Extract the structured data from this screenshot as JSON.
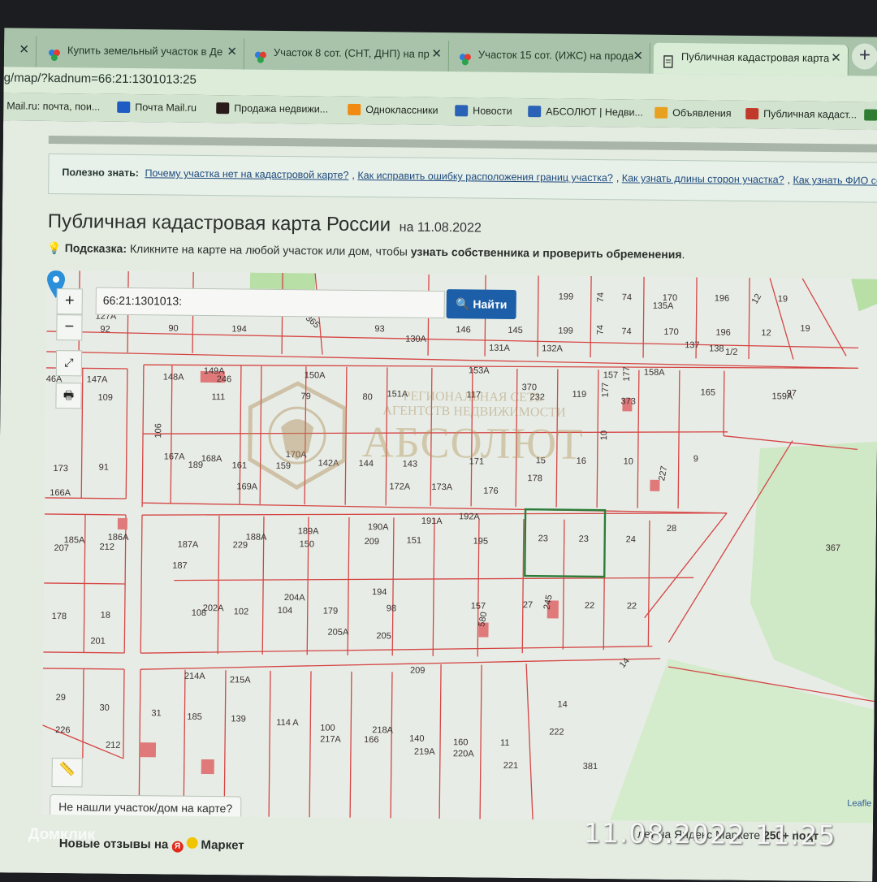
{
  "tabs": [
    {
      "label": "Купить земельный участок в Де",
      "active": false
    },
    {
      "label": "Участок 8 сот. (СНТ, ДНП) на пр",
      "active": false
    },
    {
      "label": "Участок 15 сот. (ИЖС) на прода",
      "active": false
    },
    {
      "label": "Публичная кадастровая карта -",
      "active": true
    }
  ],
  "address": "g/map/?kadnum=66:21:1301013:25",
  "bookmarks": [
    {
      "label": "Mail.ru: почта, пои...",
      "icon": "mailru-icon"
    },
    {
      "label": "Почта Mail.ru",
      "icon": "mail-icon"
    },
    {
      "label": "Продажа недвижи...",
      "icon": "site-icon"
    },
    {
      "label": "Одноклассники",
      "icon": "ok-icon"
    },
    {
      "label": "Новости",
      "icon": "vk-icon"
    },
    {
      "label": "АБСОЛЮТ | Недви...",
      "icon": "vk-icon"
    },
    {
      "label": "Объявления",
      "icon": "house-icon"
    },
    {
      "label": "Публичная кадаст...",
      "icon": "map-icon"
    }
  ],
  "info": {
    "title": "Полезно знать:",
    "links": [
      "Почему участка нет на кадастровой карте?",
      "Как исправить ошибку расположения границ участка?",
      "Как узнать длины сторон участка?",
      "Как узнать ФИО собс"
    ]
  },
  "heading": {
    "title": "Публичная кадастровая карта России",
    "date": "на 11.08.2022"
  },
  "hint": {
    "label": "Подсказка:",
    "text": "Кликните на карте на любой участок или дом, чтобы",
    "bold": "узнать собственника и проверить обременения",
    "end": "."
  },
  "map": {
    "search_value": "66:21:1301013:",
    "find_button": "Найти",
    "zoom_in": "+",
    "zoom_out": "−",
    "watermark_line1": "РЕГИОНАЛЬНАЯ СЕТЬ",
    "watermark_line2": "АГЕНТСТВ НЕДВИЖИМОСТИ",
    "watermark_brand": "АБСОЛЮТ",
    "not_found": "Не нашли участок/дом на карте?",
    "attribution": "Leafle",
    "parcel_labels": [
      "127A",
      "92",
      "90",
      "194",
      "365",
      "93",
      "130A",
      "146",
      "145",
      "199",
      "199",
      "74",
      "74",
      "74",
      "74",
      "170",
      "170",
      "135A",
      "196",
      "196",
      "12",
      "12",
      "19",
      "19",
      "131A",
      "132A",
      "137",
      "138",
      "1/2",
      "46A",
      "147A",
      "109",
      "148A",
      "149A",
      "246",
      "111",
      "150A",
      "79",
      "80",
      "151A",
      "153A",
      "117",
      "370",
      "232",
      "119",
      "157",
      "177",
      "177",
      "373",
      "158A",
      "165",
      "159A",
      "97",
      "106",
      "167A",
      "168A",
      "189",
      "161",
      "159",
      "170A",
      "142A",
      "144",
      "143",
      "171",
      "15",
      "16",
      "178",
      "10",
      "10",
      "9",
      "227",
      "173",
      "91",
      "166A",
      "169A",
      "172A",
      "173A",
      "176",
      "185A",
      "186A",
      "207",
      "212",
      "187A",
      "188A",
      "229",
      "189A",
      "150",
      "190A",
      "209",
      "191A",
      "151",
      "192A",
      "195",
      "23",
      "23",
      "24",
      "28",
      "367",
      "187",
      "204A",
      "194",
      "98",
      "157",
      "580",
      "27",
      "245",
      "22",
      "22",
      "108",
      "202A",
      "102",
      "104",
      "179",
      "178",
      "18",
      "201",
      "205A",
      "205",
      "209",
      "214A",
      "215A",
      "14",
      "29",
      "30",
      "31",
      "185",
      "139",
      "114 A",
      "100",
      "217A",
      "218A",
      "166",
      "140",
      "219A",
      "160",
      "220A",
      "11",
      "221",
      "14",
      "222",
      "381",
      "226",
      "212"
    ]
  },
  "footer": {
    "reviews_prefix": "Новые отзывы на",
    "reviews_brand": "Маркет",
    "right_text": "лет на Яндекс Маркете",
    "right_count": "250+ подт"
  },
  "overlay": {
    "timestamp": "11.08.2022 11:25",
    "watermark": "Домклик"
  }
}
